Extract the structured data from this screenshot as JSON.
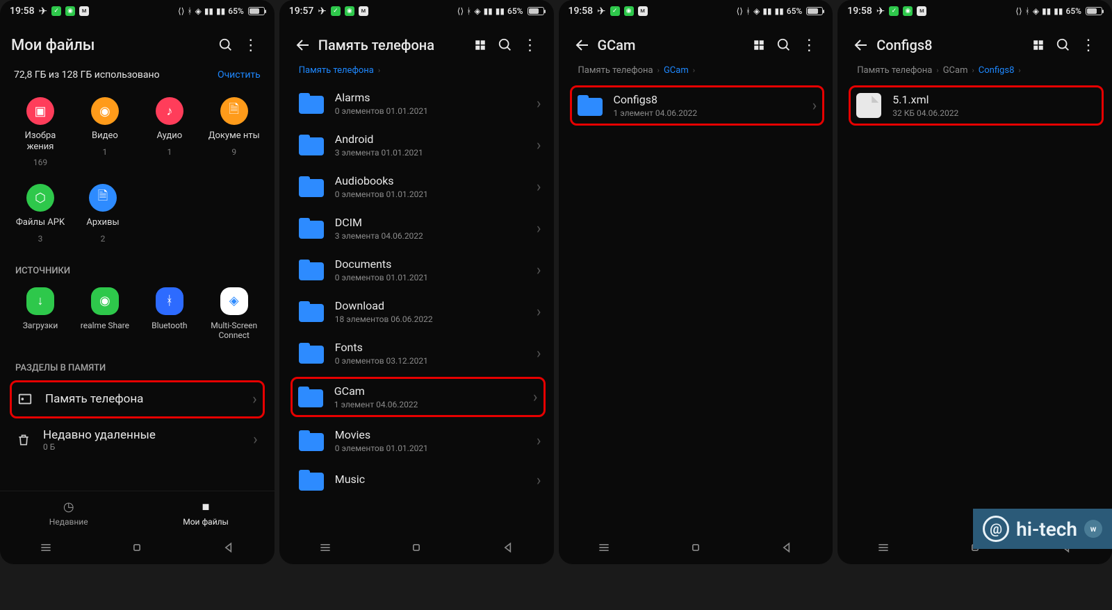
{
  "status": {
    "time_a": "19:58",
    "time_b": "19:57",
    "time_c": "19:58",
    "time_d": "19:58",
    "battery": "65%"
  },
  "s1": {
    "title": "Мои файлы",
    "storage": "72,8 ГБ из 128 ГБ использовано",
    "clear": "Очистить",
    "cats": [
      {
        "label": "Изобра жения",
        "count": "169",
        "color": "#ff3d5a"
      },
      {
        "label": "Видео",
        "count": "1",
        "color": "#ff9b1a"
      },
      {
        "label": "Аудио",
        "count": "1",
        "color": "#ff3d5a"
      },
      {
        "label": "Докуме нты",
        "count": "9",
        "color": "#ff9b1a"
      }
    ],
    "cats2": [
      {
        "label": "Файлы APK",
        "count": "3",
        "color": "#2ec84b"
      },
      {
        "label": "Архивы",
        "count": "2",
        "color": "#2d8bff"
      }
    ],
    "sec1": "ИСТОЧНИКИ",
    "src": [
      {
        "label": "Загрузки",
        "color": "#2ec84b"
      },
      {
        "label": "realme Share",
        "color": "#2ec84b"
      },
      {
        "label": "Bluetooth",
        "color": "#2d6bff"
      },
      {
        "label": "Multi-Screen Connect",
        "color": "#ffffff"
      }
    ],
    "sec2": "РАЗДЕЛЫ В ПАМЯТИ",
    "phone_storage": "Память телефона",
    "recent_del": "Недавно удаленные",
    "recent_sub": "0 Б",
    "nav_recent": "Недавние",
    "nav_files": "Мои файлы"
  },
  "s2": {
    "title": "Память телефона",
    "crumb": "Память телефона",
    "items": [
      {
        "name": "Alarms",
        "meta": "0 элементов    01.01.2021"
      },
      {
        "name": "Android",
        "meta": "3 элемента    01.01.2021"
      },
      {
        "name": "Audiobooks",
        "meta": "0 элементов    01.01.2021"
      },
      {
        "name": "DCIM",
        "meta": "3 элемента    04.06.2022"
      },
      {
        "name": "Documents",
        "meta": "0 элементов    01.01.2021"
      },
      {
        "name": "Download",
        "meta": "18 элементов    06.06.2022"
      },
      {
        "name": "Fonts",
        "meta": "0 элементов    03.12.2021"
      },
      {
        "name": "GCam",
        "meta": "1 элемент    04.06.2022",
        "hl": true
      },
      {
        "name": "Movies",
        "meta": "0 элементов    01.01.2021"
      },
      {
        "name": "Music",
        "meta": ""
      }
    ]
  },
  "s3": {
    "title": "GCam",
    "crumbs": [
      "Память телефона",
      "GCam"
    ],
    "items": [
      {
        "name": "Configs8",
        "meta": "1 элемент    04.06.2022",
        "hl": true
      }
    ]
  },
  "s4": {
    "title": "Configs8",
    "crumbs": [
      "Память телефона",
      "GCam",
      "Configs8"
    ],
    "items": [
      {
        "name": "5.1.xml",
        "meta": "32 КБ    04.06.2022",
        "hl": true,
        "file": true
      }
    ]
  },
  "watermark": "hi-tech"
}
